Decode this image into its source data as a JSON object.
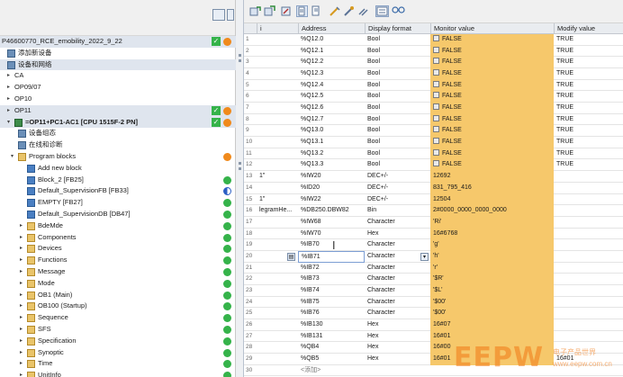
{
  "tree": {
    "items": [
      {
        "label": "P46600770_RCE_emobility_2022_9_22",
        "indent": 0,
        "twisty": "",
        "icon": "",
        "status": [
          "check",
          "orange"
        ],
        "hl": true
      },
      {
        "label": "添加新设备",
        "indent": 6,
        "twisty": "",
        "icon": "dev",
        "status": [],
        "hl": false
      },
      {
        "label": "设备和网络",
        "indent": 6,
        "twisty": "",
        "icon": "dev",
        "status": [],
        "hl": true
      },
      {
        "label": "CA",
        "indent": 6,
        "twisty": "▸",
        "icon": "",
        "status": [],
        "hl": false
      },
      {
        "label": "OP09/07",
        "indent": 6,
        "twisty": "▸",
        "icon": "",
        "status": [],
        "hl": false
      },
      {
        "label": "OP10",
        "indent": 6,
        "twisty": "▸",
        "icon": "",
        "status": [],
        "hl": false
      },
      {
        "label": "OP11",
        "indent": 6,
        "twisty": "▸",
        "icon": "",
        "status": [
          "check",
          "orange"
        ],
        "hl": true
      },
      {
        "label": "=OP11+PC1-AC1 [CPU 1515F-2 PN]",
        "indent": 6,
        "twisty": "▾",
        "icon": "plc",
        "status": [
          "check",
          "orange"
        ],
        "hl": true,
        "bold": true
      },
      {
        "label": "设备组态",
        "indent": 18,
        "twisty": "",
        "icon": "dev",
        "status": [],
        "hl": false
      },
      {
        "label": "在线和诊断",
        "indent": 18,
        "twisty": "",
        "icon": "dev",
        "status": [],
        "hl": false
      },
      {
        "label": "Program blocks",
        "indent": 10,
        "twisty": "▾",
        "icon": "folder",
        "status": [
          "orange"
        ],
        "hl": false
      },
      {
        "label": "Add new block",
        "indent": 28,
        "twisty": "",
        "icon": "block",
        "status": [],
        "hl": false
      },
      {
        "label": "Block_2 [FB25]",
        "indent": 28,
        "twisty": "",
        "icon": "block",
        "status": [
          "green"
        ],
        "hl": false
      },
      {
        "label": "Default_SupervisionFB [FB33]",
        "indent": 28,
        "twisty": "",
        "icon": "block",
        "status": [
          "blue"
        ],
        "hl": false
      },
      {
        "label": "EMPTY [FB27]",
        "indent": 28,
        "twisty": "",
        "icon": "block",
        "status": [
          "green"
        ],
        "hl": false
      },
      {
        "label": "Default_SupervisionDB [DB47]",
        "indent": 28,
        "twisty": "",
        "icon": "block",
        "status": [
          "green"
        ],
        "hl": false
      },
      {
        "label": "BdeMde",
        "indent": 20,
        "twisty": "▸",
        "icon": "folder",
        "status": [
          "green"
        ],
        "hl": false
      },
      {
        "label": "Components",
        "indent": 20,
        "twisty": "▸",
        "icon": "folder",
        "status": [
          "green"
        ],
        "hl": false
      },
      {
        "label": "Devices",
        "indent": 20,
        "twisty": "▸",
        "icon": "folder",
        "status": [
          "green"
        ],
        "hl": false
      },
      {
        "label": "Functions",
        "indent": 20,
        "twisty": "▸",
        "icon": "folder",
        "status": [
          "green"
        ],
        "hl": false
      },
      {
        "label": "Message",
        "indent": 20,
        "twisty": "▸",
        "icon": "folder",
        "status": [
          "green"
        ],
        "hl": false
      },
      {
        "label": "Mode",
        "indent": 20,
        "twisty": "▸",
        "icon": "folder",
        "status": [
          "green"
        ],
        "hl": false
      },
      {
        "label": "OB1 (Main)",
        "indent": 20,
        "twisty": "▸",
        "icon": "folder",
        "status": [
          "green"
        ],
        "hl": false
      },
      {
        "label": "OB100 (Startup)",
        "indent": 20,
        "twisty": "▸",
        "icon": "folder",
        "status": [
          "green"
        ],
        "hl": false
      },
      {
        "label": "Sequence",
        "indent": 20,
        "twisty": "▸",
        "icon": "folder",
        "status": [
          "green"
        ],
        "hl": false
      },
      {
        "label": "SFS",
        "indent": 20,
        "twisty": "▸",
        "icon": "folder",
        "status": [
          "green"
        ],
        "hl": false
      },
      {
        "label": "Specification",
        "indent": 20,
        "twisty": "▸",
        "icon": "folder",
        "status": [
          "green"
        ],
        "hl": false
      },
      {
        "label": "Synoptic",
        "indent": 20,
        "twisty": "▸",
        "icon": "folder",
        "status": [
          "green"
        ],
        "hl": false
      },
      {
        "label": "Time",
        "indent": 20,
        "twisty": "▸",
        "icon": "folder",
        "status": [
          "green"
        ],
        "hl": false
      },
      {
        "label": "UnitInfo",
        "indent": 20,
        "twisty": "▸",
        "icon": "folder",
        "status": [
          "green"
        ],
        "hl": false
      }
    ]
  },
  "table": {
    "headers": {
      "name": "i",
      "address": "Address",
      "format": "Display format",
      "monitor": "Monitor value",
      "modify": "Modify value"
    },
    "rows": [
      {
        "n": "1",
        "name": "",
        "addr": "%Q12.0",
        "fmt": "Bool",
        "mon": "FALSE",
        "bool": true,
        "mod": "TRUE"
      },
      {
        "n": "2",
        "name": "",
        "addr": "%Q12.1",
        "fmt": "Bool",
        "mon": "FALSE",
        "bool": true,
        "mod": "TRUE"
      },
      {
        "n": "3",
        "name": "",
        "addr": "%Q12.2",
        "fmt": "Bool",
        "mon": "FALSE",
        "bool": true,
        "mod": "TRUE"
      },
      {
        "n": "4",
        "name": "",
        "addr": "%Q12.3",
        "fmt": "Bool",
        "mon": "FALSE",
        "bool": true,
        "mod": "TRUE"
      },
      {
        "n": "5",
        "name": "",
        "addr": "%Q12.4",
        "fmt": "Bool",
        "mon": "FALSE",
        "bool": true,
        "mod": "TRUE"
      },
      {
        "n": "6",
        "name": "",
        "addr": "%Q12.5",
        "fmt": "Bool",
        "mon": "FALSE",
        "bool": true,
        "mod": "TRUE"
      },
      {
        "n": "7",
        "name": "",
        "addr": "%Q12.6",
        "fmt": "Bool",
        "mon": "FALSE",
        "bool": true,
        "mod": "TRUE"
      },
      {
        "n": "8",
        "name": "",
        "addr": "%Q12.7",
        "fmt": "Bool",
        "mon": "FALSE",
        "bool": true,
        "mod": "TRUE"
      },
      {
        "n": "9",
        "name": "",
        "addr": "%Q13.0",
        "fmt": "Bool",
        "mon": "FALSE",
        "bool": true,
        "mod": "TRUE"
      },
      {
        "n": "10",
        "name": "",
        "addr": "%Q13.1",
        "fmt": "Bool",
        "mon": "FALSE",
        "bool": true,
        "mod": "TRUE"
      },
      {
        "n": "11",
        "name": "",
        "addr": "%Q13.2",
        "fmt": "Bool",
        "mon": "FALSE",
        "bool": true,
        "mod": "TRUE"
      },
      {
        "n": "12",
        "name": "",
        "addr": "%Q13.3",
        "fmt": "Bool",
        "mon": "FALSE",
        "bool": true,
        "mod": "TRUE"
      },
      {
        "n": "13",
        "name": "1\"",
        "addr": "%IW20",
        "fmt": "DEC+/-",
        "mon": "12692",
        "bool": false,
        "mod": ""
      },
      {
        "n": "14",
        "name": "",
        "addr": "%ID20",
        "fmt": "DEC+/-",
        "mon": "831_795_416",
        "bool": false,
        "mod": ""
      },
      {
        "n": "15",
        "name": "1\"",
        "addr": "%IW22",
        "fmt": "DEC+/-",
        "mon": "12504",
        "bool": false,
        "mod": ""
      },
      {
        "n": "16",
        "name": "legramHe...",
        "addr": "%DB250.DBW82",
        "fmt": "Bin",
        "mon": "2#0000_0000_0000_0000",
        "bool": false,
        "mod": ""
      },
      {
        "n": "17",
        "name": "",
        "addr": "%IW68",
        "fmt": "Character",
        "mon": "'Ri'",
        "bool": false,
        "mod": ""
      },
      {
        "n": "18",
        "name": "",
        "addr": "%IW70",
        "fmt": "Hex",
        "mon": "16#6768",
        "bool": false,
        "mod": ""
      },
      {
        "n": "19",
        "name": "",
        "addr": "%IB70",
        "fmt": "Character",
        "mon": "'g'",
        "bool": false,
        "mod": ""
      },
      {
        "n": "20",
        "name": "",
        "addr": "%IB71",
        "fmt": "Character",
        "mon": "'h'",
        "bool": false,
        "mod": "",
        "editing": true
      },
      {
        "n": "21",
        "name": "",
        "addr": "%IB72",
        "fmt": "Character",
        "mon": "'r'",
        "bool": false,
        "mod": ""
      },
      {
        "n": "22",
        "name": "",
        "addr": "%IB73",
        "fmt": "Character",
        "mon": "'$R'",
        "bool": false,
        "mod": ""
      },
      {
        "n": "23",
        "name": "",
        "addr": "%IB74",
        "fmt": "Character",
        "mon": "'$L'",
        "bool": false,
        "mod": ""
      },
      {
        "n": "24",
        "name": "",
        "addr": "%IB75",
        "fmt": "Character",
        "mon": "'$00'",
        "bool": false,
        "mod": ""
      },
      {
        "n": "25",
        "name": "",
        "addr": "%IB76",
        "fmt": "Character",
        "mon": "'$00'",
        "bool": false,
        "mod": ""
      },
      {
        "n": "26",
        "name": "",
        "addr": "%IB130",
        "fmt": "Hex",
        "mon": "16#07",
        "bool": false,
        "mod": ""
      },
      {
        "n": "27",
        "name": "",
        "addr": "%IB131",
        "fmt": "Hex",
        "mon": "16#01",
        "bool": false,
        "mod": ""
      },
      {
        "n": "28",
        "name": "",
        "addr": "%QB4",
        "fmt": "Hex",
        "mon": "16#00",
        "bool": false,
        "mod": ""
      },
      {
        "n": "29",
        "name": "",
        "addr": "%QB5",
        "fmt": "Hex",
        "mon": "16#01",
        "bool": false,
        "mod": "16#01"
      },
      {
        "n": "30",
        "name": "",
        "addr": "<添加>",
        "fmt": "",
        "mon": "",
        "bool": false,
        "mod": "",
        "add": true
      }
    ]
  },
  "watermark": {
    "main": "EEPW",
    "sub1": "电子产品世界",
    "sub2": "www.eepw.com.cn"
  },
  "colors": {
    "monitor_bg": "#f6c86b",
    "status_green": "#35b34a",
    "status_orange": "#f08a1c"
  }
}
